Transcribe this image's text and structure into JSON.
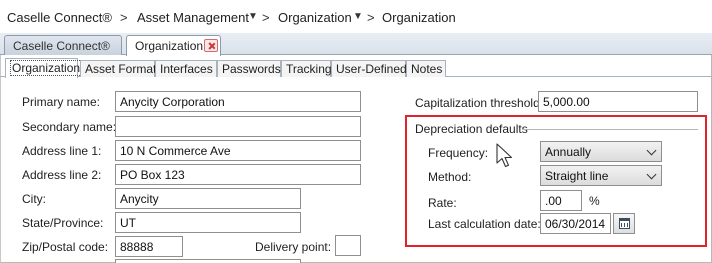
{
  "breadcrumb": {
    "items": [
      "Caselle Connect®",
      "Asset Management",
      "Organization",
      "Organization"
    ]
  },
  "window_tabs": [
    {
      "label": "Caselle Connect®"
    },
    {
      "label": "Organization"
    }
  ],
  "inner_tabs": [
    "Organization",
    "Asset Format",
    "Interfaces",
    "Passwords",
    "Tracking",
    "User-Defined",
    "Notes"
  ],
  "form": {
    "primary_name": {
      "label": "Primary name:",
      "value": "Anycity Corporation"
    },
    "secondary_name": {
      "label": "Secondary name:",
      "value": ""
    },
    "address_line_1": {
      "label": "Address line 1:",
      "value": "10 N Commerce Ave"
    },
    "address_line_2": {
      "label": "Address line 2:",
      "value": "PO Box 123"
    },
    "city": {
      "label": "City:",
      "value": "Anycity"
    },
    "state": {
      "label": "State/Province:",
      "value": "UT"
    },
    "zip": {
      "label": "Zip/Postal code:",
      "value": "88888"
    },
    "delivery_point": {
      "label": "Delivery point:",
      "value": ""
    },
    "capitalization_threshold": {
      "label": "Capitalization threshold:",
      "value": "5,000.00"
    }
  },
  "depreciation": {
    "title": "Depreciation defaults",
    "frequency": {
      "label": "Frequency:",
      "value": "Annually"
    },
    "method": {
      "label": "Method:",
      "value": "Straight line"
    },
    "rate": {
      "label": "Rate:",
      "value": ".00",
      "unit": "%"
    },
    "last_calculation_date": {
      "label": "Last calculation date:",
      "value": "06/30/2014"
    }
  },
  "colors": {
    "highlight": "#e0222b",
    "close_icon": "#c23b3b"
  },
  "icons": {
    "calendar": "calendar-icon",
    "close": "close-icon",
    "chevron": "chevron-down-icon"
  }
}
